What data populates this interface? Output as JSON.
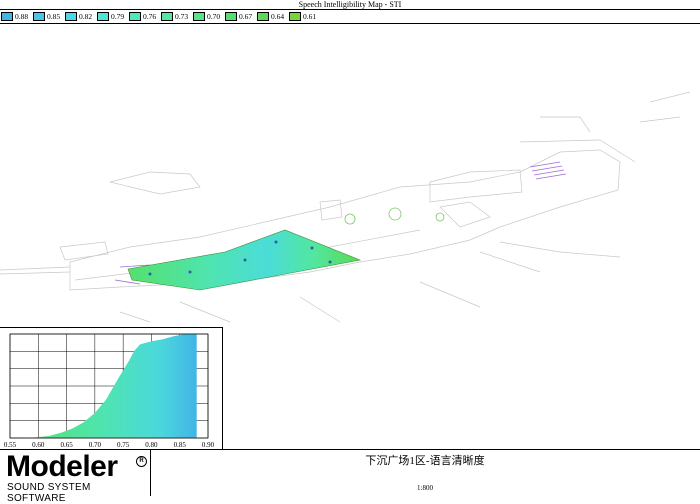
{
  "map_title": "Speech Intelligibility Map - STI",
  "legend": [
    {
      "label": "0.88",
      "color": "#42b4e6"
    },
    {
      "label": "0.85",
      "color": "#47c6e8"
    },
    {
      "label": "0.82",
      "color": "#4ad8e6"
    },
    {
      "label": "0.79",
      "color": "#4ee4d6"
    },
    {
      "label": "0.76",
      "color": "#52e6bd"
    },
    {
      "label": "0.73",
      "color": "#55e6a3"
    },
    {
      "label": "0.70",
      "color": "#55e689"
    },
    {
      "label": "0.67",
      "color": "#55e06c"
    },
    {
      "label": "0.64",
      "color": "#5ada52"
    },
    {
      "label": "0.61",
      "color": "#74d63a"
    }
  ],
  "chart_data": {
    "type": "area",
    "x": [
      0.55,
      0.58,
      0.6,
      0.62,
      0.64,
      0.66,
      0.68,
      0.7,
      0.72,
      0.74,
      0.76,
      0.77,
      0.78,
      0.8,
      0.82,
      0.84,
      0.86,
      0.875,
      0.88
    ],
    "values": [
      0,
      0,
      1,
      2,
      5,
      9,
      15,
      24,
      37,
      56,
      74,
      84,
      90,
      93,
      95,
      98,
      100,
      100,
      100
    ],
    "xticks": [
      "0.55",
      "0.60",
      "0.65",
      "0.70",
      "0.75",
      "0.80",
      "0.85",
      "0.90"
    ],
    "xlim": [
      0.55,
      0.9
    ],
    "ylim": [
      0,
      100
    ],
    "grid": true,
    "title": "",
    "xlabel": "",
    "ylabel": ""
  },
  "footer": {
    "logo_word": "Modeler",
    "logo_reg": "R",
    "logo_sub": "SOUND SYSTEM SOFTWARE",
    "drawing_title": "下沉广场1区-语言清晰度",
    "scale": "1:800"
  }
}
